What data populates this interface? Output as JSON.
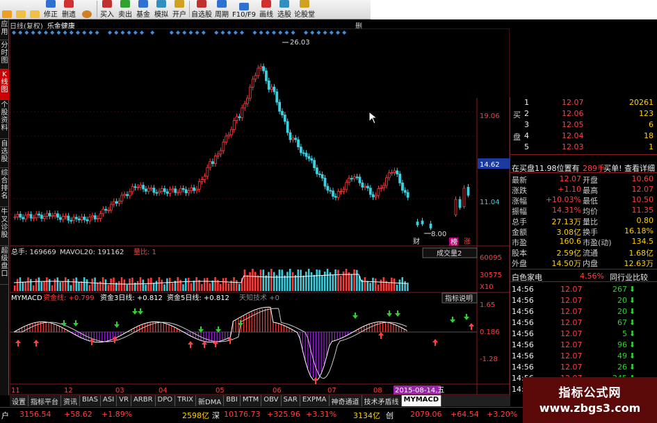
{
  "toolbar": {
    "buttons": [
      {
        "label": "",
        "icon": "back-icon"
      },
      {
        "label": "",
        "icon": "up-icon"
      },
      {
        "label": "",
        "icon": "down-icon"
      },
      {
        "label": "修正",
        "icon": "edit-icon"
      },
      {
        "label": "删遗",
        "icon": "delete-icon"
      },
      {
        "label": "",
        "icon": "clock-icon"
      },
      {
        "label": "买入",
        "icon": "buy-icon"
      },
      {
        "label": "卖出",
        "icon": "sell-icon"
      },
      {
        "label": "基金",
        "icon": "fund-icon"
      },
      {
        "label": "模拟",
        "icon": "simulate-icon"
      },
      {
        "label": "开户",
        "icon": "account-icon"
      },
      {
        "label": "自选股",
        "icon": "watchlist-icon"
      },
      {
        "label": "周期",
        "icon": "period-icon"
      },
      {
        "label": "F10/F9",
        "icon": "f10-icon"
      },
      {
        "label": "画线",
        "icon": "draw-icon"
      },
      {
        "label": "选股",
        "icon": "pick-icon"
      },
      {
        "label": "论股堂",
        "icon": "forum-icon"
      }
    ]
  },
  "left_tabs": [
    "应用",
    "分时图",
    "K线图",
    "个股资料",
    "自选股",
    "综合排名",
    "牛叉诊股",
    "超级盘口"
  ],
  "chart_header": {
    "period": "日线(复权)",
    "stock": "乐金健康",
    "corner": "删"
  },
  "price_chart": {
    "high_label": "26.03",
    "low_label": "8.00",
    "axis": [
      "19.06",
      "14.62",
      "11.04"
    ],
    "marks": [
      "财",
      "榜",
      "涨"
    ]
  },
  "volume": {
    "title": "总手: 169669",
    "ma": "MAVOL20: 191162",
    "ratio": "量比: 1",
    "dropdown": "成交量2",
    "axis": [
      "60095",
      "30575",
      "X10"
    ]
  },
  "macd": {
    "name": "MYMACD",
    "line1": "资金线: +0.799",
    "line2": "资金3日线: +0.812",
    "line3": "资金5日线: +0.812",
    "extra": "天知技术 +0",
    "button": "指标说明",
    "axis": [
      "1.65",
      "0.186",
      "-1.28"
    ]
  },
  "xaxis": {
    "labels": [
      "11",
      "12",
      "03",
      "04",
      "05",
      "06",
      "07",
      "08"
    ],
    "date_tag": "2015-08-14,五"
  },
  "order_book": {
    "rows": [
      {
        "side": "",
        "idx": "1",
        "price": "12.07",
        "vol": "20261"
      },
      {
        "side": "买",
        "idx": "2",
        "price": "12.06",
        "vol": "123"
      },
      {
        "side": "",
        "idx": "3",
        "price": "12.05",
        "vol": "6"
      },
      {
        "side": "盘",
        "idx": "4",
        "price": "12.04",
        "vol": "18"
      },
      {
        "side": "",
        "idx": "5",
        "price": "12.03",
        "vol": "1"
      }
    ],
    "queue": "在买盘11.98位置有",
    "queue_vol": "289手",
    "queue_link": "买单! 查看详细"
  },
  "quote": [
    {
      "k1": "最新",
      "v1": "12.07",
      "k2": "开盘",
      "v2": "10.60"
    },
    {
      "k1": "涨跌",
      "v1": "+1.10",
      "k2": "最高",
      "v2": "12.07"
    },
    {
      "k1": "涨幅",
      "v1": "+10.03%",
      "k2": "最低",
      "v2": "10.50"
    },
    {
      "k1": "振幅",
      "v1": "14.31%",
      "k2": "均价",
      "v2": "11.35"
    },
    {
      "k1": "总手",
      "v1": "27.13万",
      "k2": "量比",
      "v2": "0.80"
    },
    {
      "k1": "金额",
      "v1": "3.08亿",
      "k2": "换手",
      "v2": "16.18%"
    },
    {
      "k1": "市盈",
      "v1": "160.6",
      "k2": "市盈(动)",
      "v2": "134.5"
    },
    {
      "k1": "股本",
      "v1": "2.59亿",
      "k2": "流通",
      "v2": "1.68亿"
    },
    {
      "k1": "外盘",
      "v1": "14.50万",
      "k2": "内盘",
      "v2": "12.63万"
    }
  ],
  "sector": {
    "name": "白色家电",
    "pct": "4.56%",
    "button": "同行业比较"
  },
  "ticks": [
    {
      "time": "14:56",
      "price": "12.07",
      "vol": "267"
    },
    {
      "time": "14:56",
      "price": "12.07",
      "vol": "20"
    },
    {
      "time": "14:56",
      "price": "12.07",
      "vol": "20"
    },
    {
      "time": "14:56",
      "price": "12.07",
      "vol": "67"
    },
    {
      "time": "14:56",
      "price": "12.07",
      "vol": "5"
    },
    {
      "time": "14:56",
      "price": "12.07",
      "vol": "96"
    },
    {
      "time": "14:56",
      "price": "12.07",
      "vol": "49"
    },
    {
      "time": "14:56",
      "price": "12.07",
      "vol": "26"
    },
    {
      "time": "14:56",
      "price": "12.07",
      "vol": "245"
    },
    {
      "time": "14:56",
      "price": "12.07",
      "vol": "36"
    }
  ],
  "bottom_tabs": [
    "设置",
    "指标平台",
    "资讯",
    "BIAS",
    "ASI",
    "VR",
    "ARBR",
    "DPO",
    "TRIX",
    "新DMA",
    "BBI",
    "MTM",
    "OBV",
    "SAR",
    "EXPMA",
    "神奇通道",
    "技术矛盾线",
    "MYMACD"
  ],
  "status": {
    "s1": "户",
    "s2": "3156.54",
    "s3": "+58.62",
    "s4": "+1.89%",
    "s5": "2598亿",
    "s6": "深",
    "s7": "10176.73",
    "s8": "+325.96",
    "s9": "+3.31%",
    "s10": "3134亿",
    "s11": "创",
    "s12": "2079.06",
    "s13": "+64.54",
    "s14": "+3.20%"
  },
  "watermark": {
    "line1": "指标公式网",
    "line2": "www.zbgs3.com"
  }
}
